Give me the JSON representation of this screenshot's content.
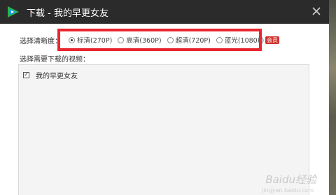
{
  "window": {
    "title": "下载 - 我的早更女友",
    "app_icon": "tencent-video-logo",
    "close_icon": "close-icon"
  },
  "resolution": {
    "label": "选择清晰度：",
    "options": [
      {
        "label": "标清(270P)",
        "selected": true
      },
      {
        "label": "高清(360P)",
        "selected": false
      },
      {
        "label": "超清(720P)",
        "selected": false
      },
      {
        "label": "蓝光(1080P)",
        "selected": false
      }
    ],
    "vip_badge": "会员"
  },
  "video_select": {
    "label": "选择需要下载的视频：",
    "items": [
      {
        "label": "我的早更女友",
        "checked": true
      }
    ]
  },
  "watermark": {
    "main": "Baidu经验",
    "sub": "jingyan.baidu.com"
  },
  "colors": {
    "titlebar": "#2b2b2b",
    "highlight": "#e8262e",
    "vip": "#d0312d",
    "logo_green": "#2bb24c",
    "logo_blue": "#1e9af0"
  }
}
